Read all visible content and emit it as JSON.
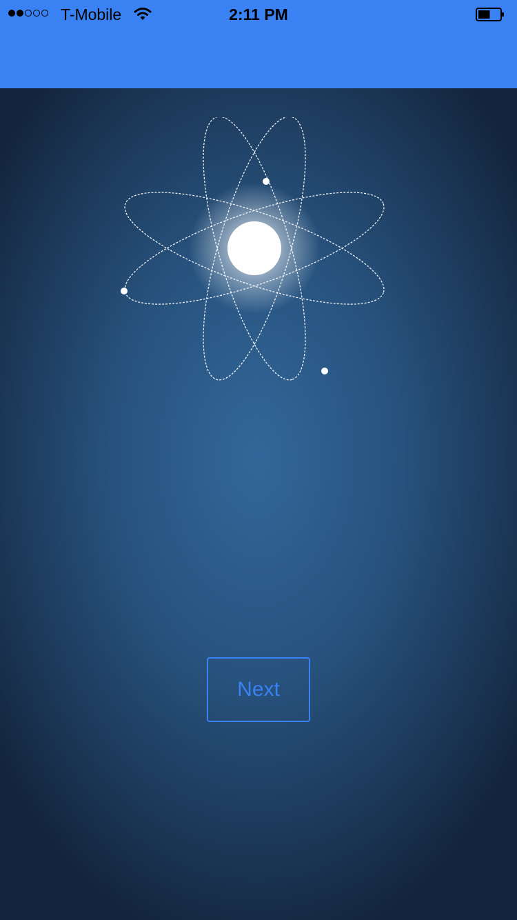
{
  "status_bar": {
    "carrier": "T-Mobile",
    "time": "2:11 PM",
    "signal_bars_filled": 2,
    "signal_bars_total": 5,
    "battery_level": 0.55
  },
  "onboarding": {
    "next_label": "Next",
    "accent_color": "#3a82f3",
    "illustration_icon": "atom-icon"
  }
}
